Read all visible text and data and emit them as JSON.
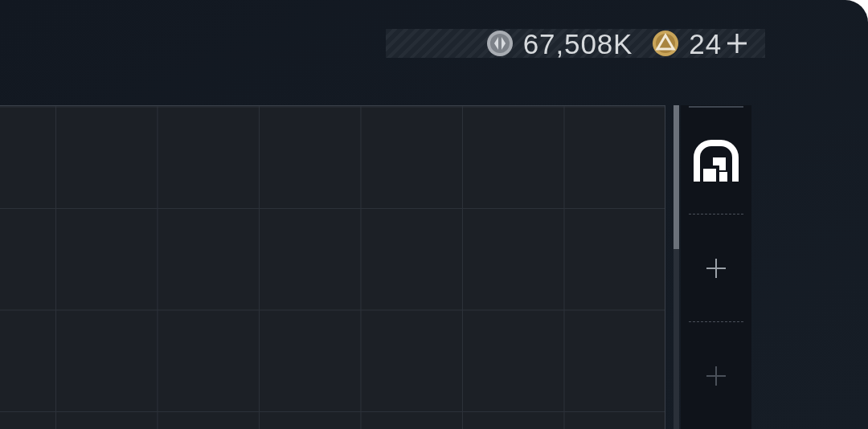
{
  "currencies": [
    {
      "kind": "silver",
      "amount": "67,508K",
      "add": false
    },
    {
      "kind": "gold",
      "amount": "24",
      "add": true
    }
  ],
  "slots": [
    {
      "kind": "filled"
    },
    {
      "kind": "add",
      "disabled": false
    },
    {
      "kind": "add",
      "disabled": true
    }
  ]
}
